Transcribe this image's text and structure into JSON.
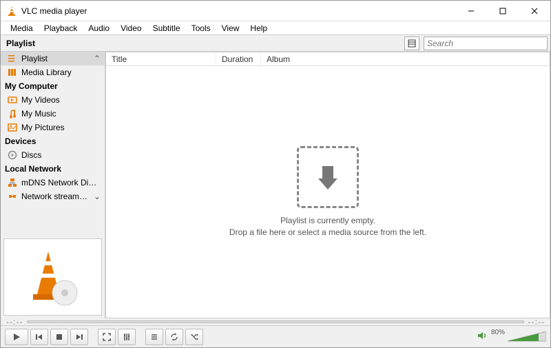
{
  "window": {
    "title": "VLC media player"
  },
  "menu": [
    "Media",
    "Playback",
    "Audio",
    "Video",
    "Subtitle",
    "Tools",
    "View",
    "Help"
  ],
  "toolbar": {
    "label": "Playlist",
    "search_placeholder": "Search"
  },
  "sidebar": {
    "groups": [
      {
        "label": "Playlist",
        "items": [
          {
            "label": "Playlist",
            "icon": "playlist-icon",
            "selected": true
          },
          {
            "label": "Media Library",
            "icon": "library-icon"
          }
        ]
      },
      {
        "label": "My Computer",
        "items": [
          {
            "label": "My Videos",
            "icon": "video-icon"
          },
          {
            "label": "My Music",
            "icon": "music-icon"
          },
          {
            "label": "My Pictures",
            "icon": "picture-icon"
          }
        ]
      },
      {
        "label": "Devices",
        "items": [
          {
            "label": "Discs",
            "icon": "disc-icon"
          }
        ]
      },
      {
        "label": "Local Network",
        "items": [
          {
            "label": "mDNS Network Disco...",
            "icon": "network-icon"
          },
          {
            "label": "Network streams (SAP)",
            "icon": "stream-icon"
          }
        ]
      }
    ]
  },
  "columns": [
    "Title",
    "Duration",
    "Album"
  ],
  "empty": {
    "line1": "Playlist is currently empty.",
    "line2": "Drop a file here or select a media source from the left."
  },
  "time": {
    "left": "--:--",
    "right": "--:--"
  },
  "volume": {
    "percent": "80%"
  }
}
